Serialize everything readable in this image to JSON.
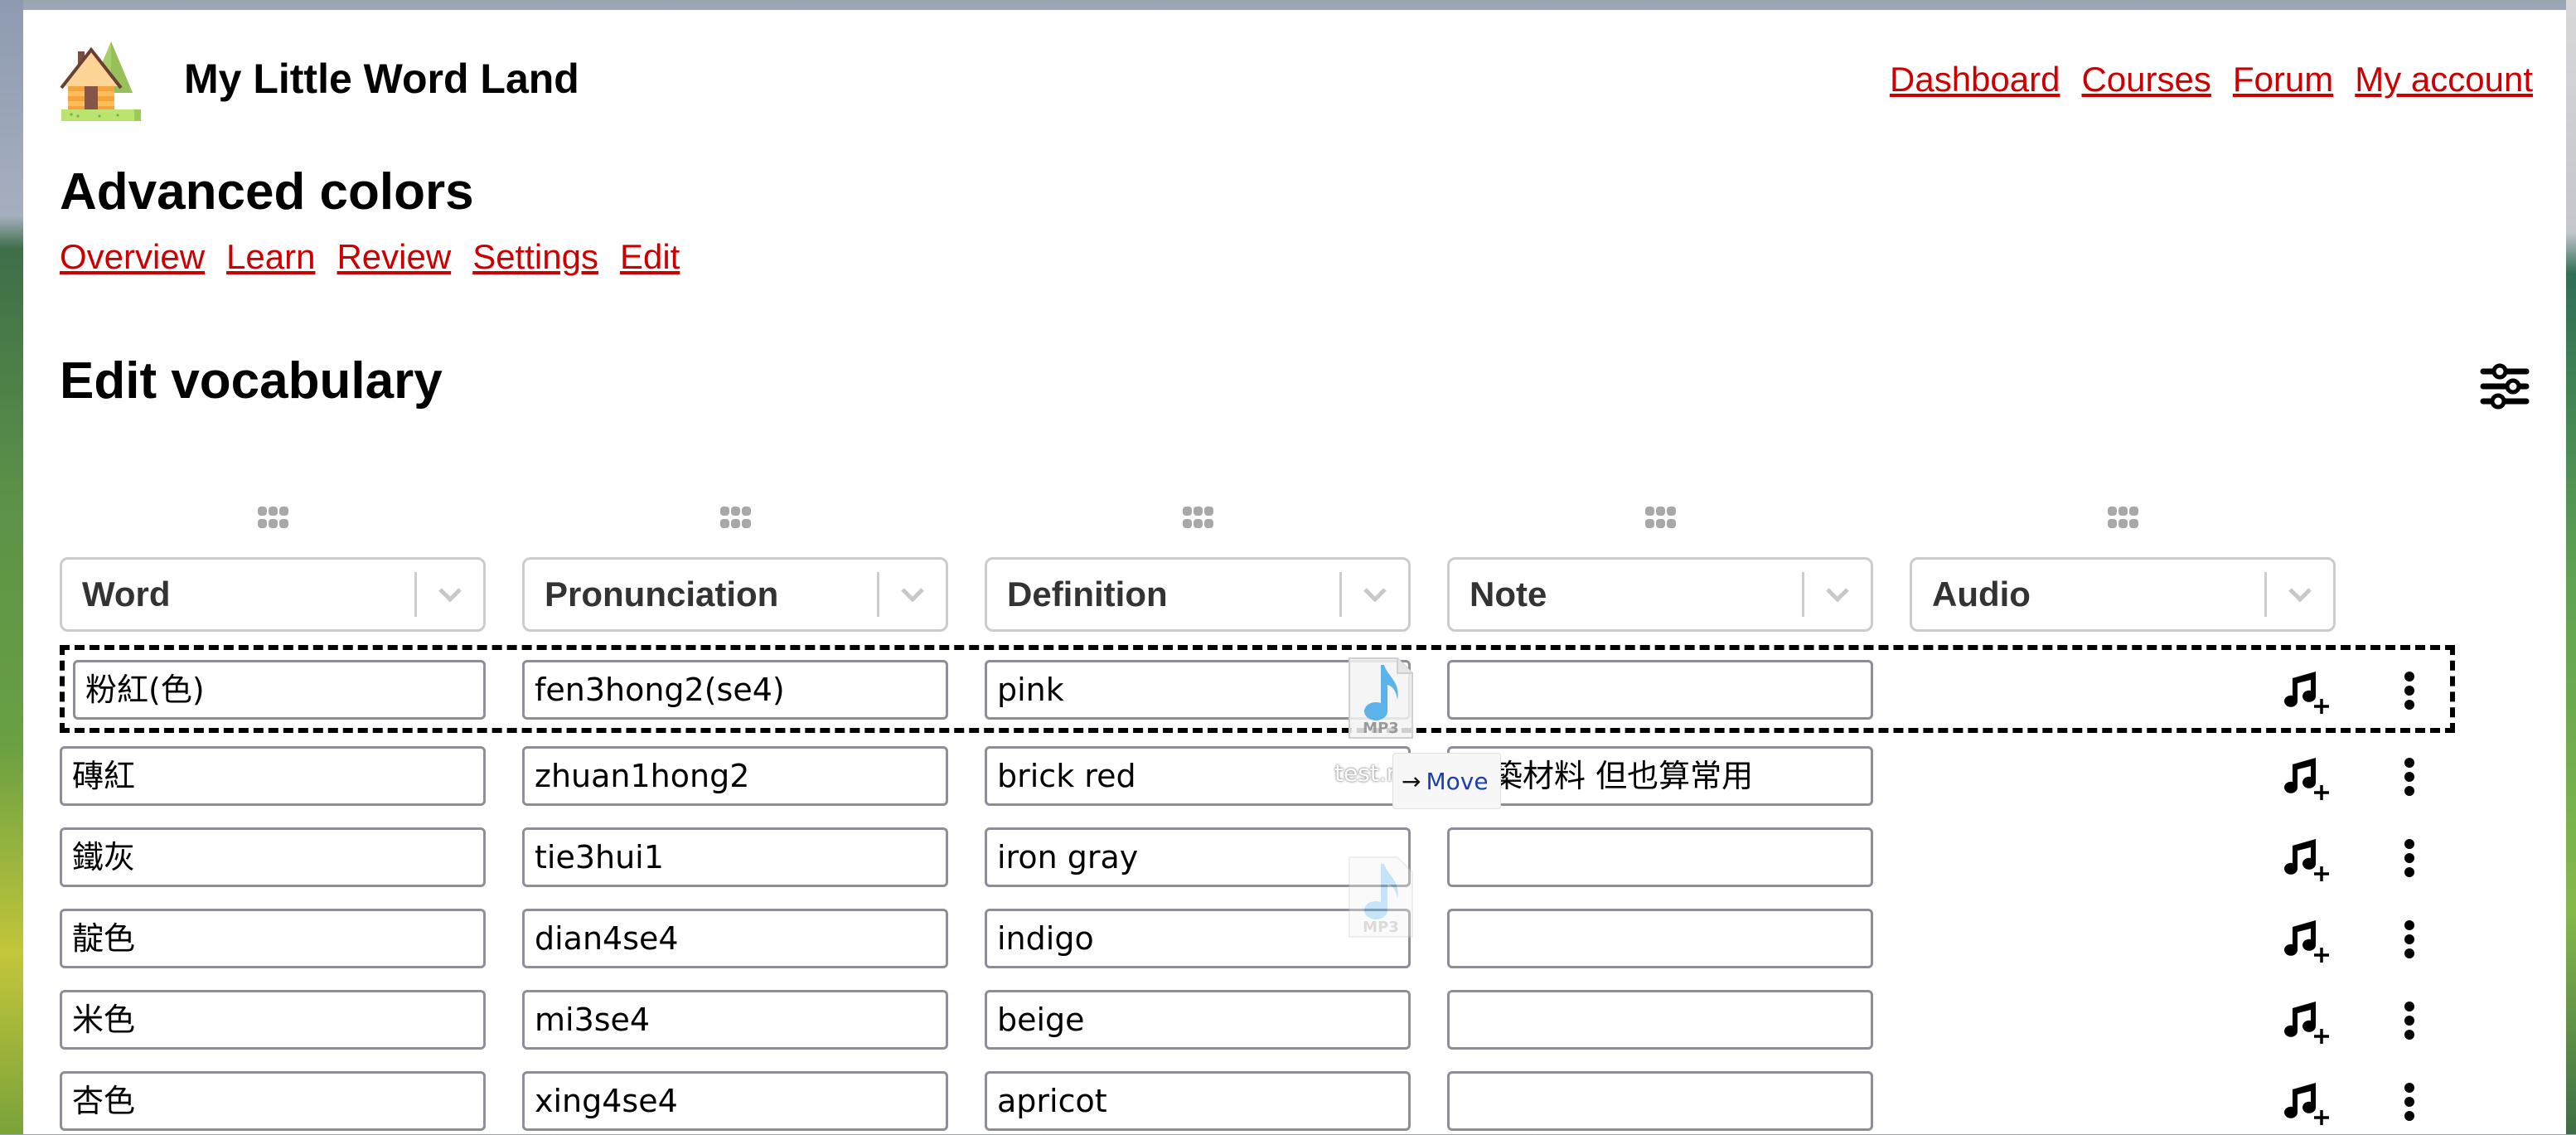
{
  "site": {
    "title": "My Little Word Land",
    "logo_icon": "house-tree-logo"
  },
  "topnav": [
    "Dashboard",
    "Courses",
    "Forum",
    "My account"
  ],
  "course": {
    "title": "Advanced colors",
    "tabs": [
      "Overview",
      "Learn",
      "Review",
      "Settings",
      "Edit"
    ]
  },
  "editor": {
    "title": "Edit vocabulary",
    "filter_icon": "sliders-icon",
    "columns": [
      "Word",
      "Pronunciation",
      "Definition",
      "Note",
      "Audio"
    ],
    "rows": [
      {
        "word": "粉紅(色)",
        "pronunciation": "fen3hong2(se4)",
        "definition": "pink",
        "note": ""
      },
      {
        "word": "磚紅",
        "pronunciation": "zhuan1hong2",
        "definition": "brick red",
        "note": "建築材料 但也算常用"
      },
      {
        "word": "鐵灰",
        "pronunciation": "tie3hui1",
        "definition": "iron gray",
        "note": ""
      },
      {
        "word": "靛色",
        "pronunciation": "dian4se4",
        "definition": "indigo",
        "note": ""
      },
      {
        "word": "米色",
        "pronunciation": "mi3se4",
        "definition": "beige",
        "note": ""
      },
      {
        "word": "杏色",
        "pronunciation": "xing4se4",
        "definition": "apricot",
        "note": ""
      }
    ],
    "row_actions": {
      "audio": "add-audio-icon",
      "more": "more-vertical-icon"
    }
  },
  "drag": {
    "file_label": "MP3",
    "filename": "test.mp3",
    "filename_visible": "test.n",
    "action": "Move"
  },
  "colors": {
    "link": "#cc0000",
    "move_text": "#1a3fb0",
    "mp3_blue": "#5bb3ea"
  }
}
